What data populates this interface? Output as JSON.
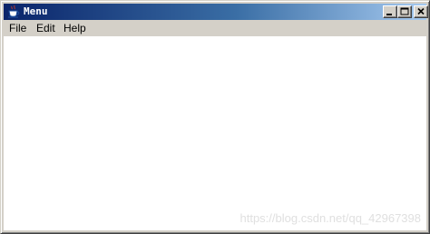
{
  "window": {
    "title": "Menu"
  },
  "title_bar": {
    "minimize_icon": "minimize-icon",
    "maximize_icon": "maximize-icon",
    "close_icon": "close-icon"
  },
  "menubar": {
    "items": [
      {
        "label": "File"
      },
      {
        "label": "Edit"
      },
      {
        "label": "Help"
      }
    ]
  },
  "watermark": {
    "text": "https://blog.csdn.net/qq_42967398"
  },
  "colors": {
    "title_gradient_start": "#0a246a",
    "title_gradient_end": "#a6caf0",
    "chrome": "#d4d0c8",
    "content_background": "#ffffff"
  }
}
